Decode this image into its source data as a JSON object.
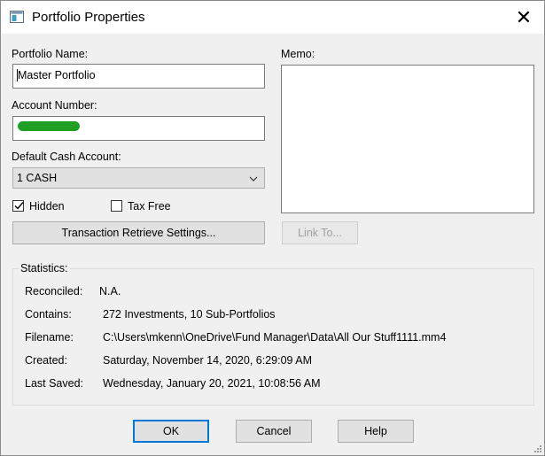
{
  "window": {
    "title": "Portfolio Properties",
    "close_glyph": "✕"
  },
  "form": {
    "portfolio_name_label": "Portfolio Name:",
    "portfolio_name_value": "Master Portfolio",
    "account_number_label": "Account Number:",
    "default_cash_label": "Default Cash Account:",
    "default_cash_value": "1 CASH",
    "hidden_label": "Hidden",
    "hidden_checked": true,
    "tax_free_label": "Tax Free",
    "tax_free_checked": false,
    "transaction_button": "Transaction Retrieve Settings...",
    "memo_label": "Memo:",
    "link_to_button": "Link To..."
  },
  "statistics": {
    "title": "Statistics:",
    "rows": [
      {
        "label": "Reconciled:",
        "value": "N.A."
      },
      {
        "label": "Contains:",
        "value": "272 Investments, 10 Sub-Portfolios"
      },
      {
        "label": "Filename:",
        "value": "C:\\Users\\mkenn\\OneDrive\\Fund Manager\\Data\\All Our Stuff1111.mm4"
      },
      {
        "label": "Created:",
        "value": "Saturday, November 14, 2020, 6:29:09 AM"
      },
      {
        "label": "Last Saved:",
        "value": "Wednesday, January 20, 2021, 10:08:56 AM"
      }
    ]
  },
  "buttons": {
    "ok": "OK",
    "cancel": "Cancel",
    "help": "Help"
  },
  "colors": {
    "accent": "#0078d7",
    "redaction": "#1fa024"
  },
  "icons": [
    "window-icon",
    "close-icon",
    "chevron-down-icon",
    "checkmark-icon",
    "resize-grip-icon"
  ]
}
